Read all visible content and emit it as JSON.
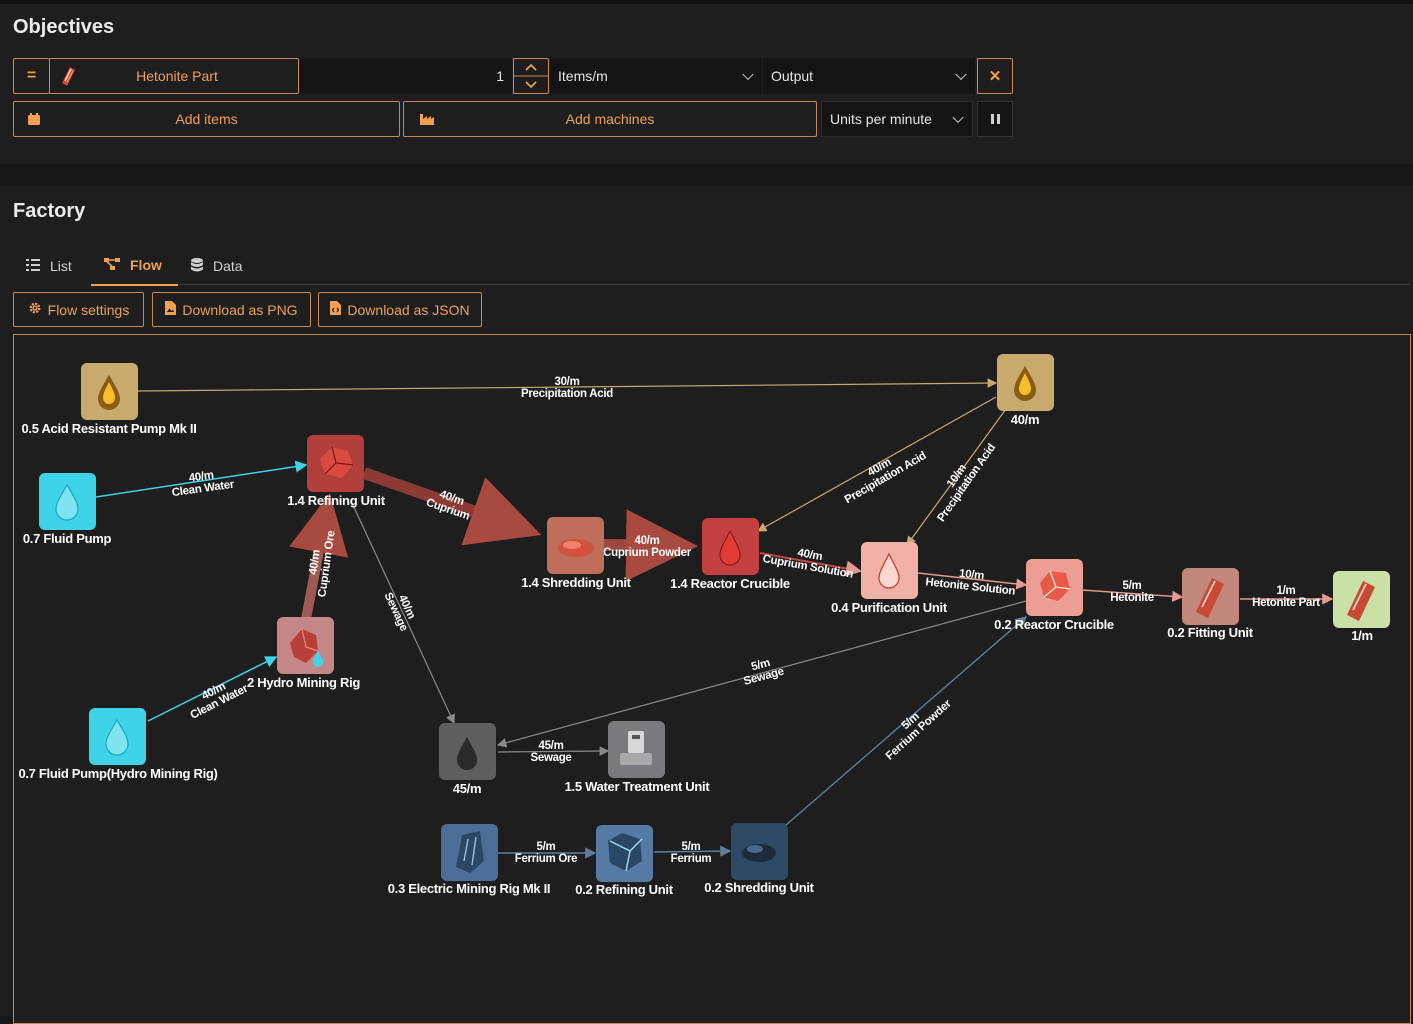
{
  "objectives": {
    "title": "Objectives",
    "row": {
      "item_name": "Hetonite Part",
      "quantity": "1",
      "rate_unit": "Items/m",
      "type": "Output"
    },
    "add_items_label": "Add items",
    "add_machines_label": "Add machines",
    "display_rate": "Units per minute"
  },
  "factory": {
    "title": "Factory",
    "tabs": [
      {
        "label": "List",
        "icon": "list-icon"
      },
      {
        "label": "Flow",
        "icon": "flow-icon",
        "active": true
      },
      {
        "label": "Data",
        "icon": "database-icon"
      }
    ],
    "actions": {
      "flow_settings": "Flow settings",
      "download_png": "Download as PNG",
      "download_json": "Download as JSON"
    }
  },
  "flow": {
    "nodes": {
      "acid_pump": {
        "label": "0.5 Acid Resistant Pump Mk II",
        "icon": "acid-drop-icon",
        "color": "#c8aa6e"
      },
      "acid_out": {
        "label": "40/m",
        "icon": "acid-drop-icon",
        "color": "#c8aa6e"
      },
      "fluid_pump": {
        "label": "0.7 Fluid Pump",
        "icon": "water-drop-icon",
        "color": "#3ed3e8"
      },
      "refining_1": {
        "label": "1.4 Refining Unit",
        "icon": "cuprium-ore-icon",
        "color": "#b1403a"
      },
      "shredding_1": {
        "label": "1.4 Shredding Unit",
        "icon": "cuprium-powder-icon",
        "color": "#bf6e5c"
      },
      "reactor_1": {
        "label": "1.4 Reactor Crucible",
        "icon": "cuprium-solution-icon",
        "color": "#c43f3f"
      },
      "purification": {
        "label": "0.4 Purification Unit",
        "icon": "hetonite-solution-icon",
        "color": "#f0b1a8"
      },
      "reactor_2": {
        "label": "0.2 Reactor Crucible",
        "icon": "hetonite-icon",
        "color": "#ec9e94"
      },
      "fitting": {
        "label": "0.2 Fitting Unit",
        "icon": "hetonite-part-icon",
        "color": "#c3887c"
      },
      "output": {
        "label": "1/m",
        "icon": "hetonite-part-icon",
        "color": "#cbe0a6"
      },
      "hydro_rig": {
        "label": "2 Hydro Mining Rig",
        "icon": "hydro-ore-icon",
        "color": "#c48686"
      },
      "fluid_pump_2": {
        "label": "0.7 Fluid Pump(Hydro Mining Rig)",
        "icon": "water-drop-icon",
        "color": "#3ed3e8"
      },
      "sewage": {
        "label": "45/m",
        "icon": "sewage-drop-icon",
        "color": "#5e5e5e"
      },
      "water_treatment": {
        "label": "1.5 Water Treatment Unit",
        "icon": "water-treatment-icon",
        "color": "#7a7a7e"
      },
      "mining_rig": {
        "label": "0.3 Electric Mining Rig Mk II",
        "icon": "ferrium-ore-icon",
        "color": "#4c6e96"
      },
      "refining_2": {
        "label": "0.2 Refining Unit",
        "icon": "ferrium-icon",
        "color": "#557aa3"
      },
      "shredding_2": {
        "label": "0.2 Shredding Unit",
        "icon": "ferrium-powder-icon",
        "color": "#2e4a66"
      }
    },
    "edges": [
      {
        "rate": "30/m",
        "item": "Precipitation Acid"
      },
      {
        "rate": "40/m",
        "item": "Clean Water"
      },
      {
        "rate": "40/m",
        "item": "Cuprium"
      },
      {
        "rate": "40/m",
        "item": "Cuprium Powder"
      },
      {
        "rate": "40/m",
        "item": "Cuprium Solution"
      },
      {
        "rate": "40/m",
        "item": "Precipitation Acid"
      },
      {
        "rate": "10/m",
        "item": "Precipitation Acid"
      },
      {
        "rate": "10/m",
        "item": "Hetonite Solution"
      },
      {
        "rate": "5/m",
        "item": "Hetonite"
      },
      {
        "rate": "1/m",
        "item": "Hetonite Part"
      },
      {
        "rate": "40/m",
        "item": "Cuprium Ore"
      },
      {
        "rate": "40/m",
        "item": "Clean Water"
      },
      {
        "rate": "40/m",
        "item": "Sewage"
      },
      {
        "rate": "5/m",
        "item": "Sewage"
      },
      {
        "rate": "45/m",
        "item": "Sewage"
      },
      {
        "rate": "5/m",
        "item": "Ferrium Ore"
      },
      {
        "rate": "5/m",
        "item": "Ferrium"
      },
      {
        "rate": "5/m",
        "item": "Ferrium Powder"
      }
    ]
  }
}
